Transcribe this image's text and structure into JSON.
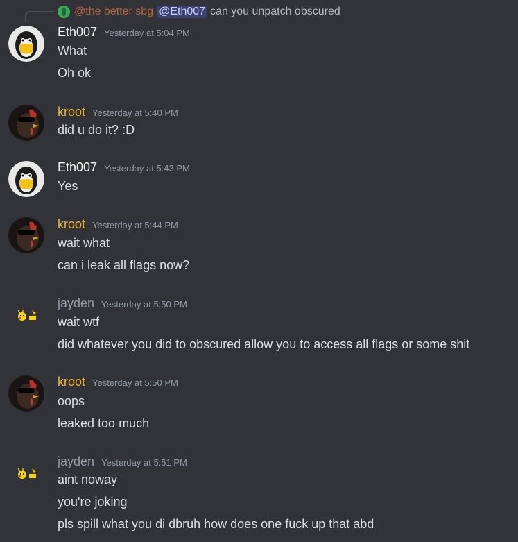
{
  "reply": {
    "author": "@the better sbg",
    "mention": "@Eth007",
    "text": "can you unpatch obscured"
  },
  "groups": [
    {
      "author": "Eth007",
      "author_color": "#f2f3f5",
      "avatar_icon": "penguin-mask-avatar",
      "timestamp": "Yesterday at 5:04 PM",
      "messages": [
        "What",
        "Oh ok"
      ]
    },
    {
      "author": "kroot",
      "author_color": "#f0b232",
      "avatar_icon": "rooster-sunglasses-avatar",
      "timestamp": "Yesterday at 5:40 PM",
      "messages": [
        "did u do it? :D"
      ]
    },
    {
      "author": "Eth007",
      "author_color": "#f2f3f5",
      "avatar_icon": "penguin-mask-avatar",
      "timestamp": "Yesterday at 5:43 PM",
      "messages": [
        "Yes"
      ]
    },
    {
      "author": "kroot",
      "author_color": "#f0b232",
      "avatar_icon": "rooster-sunglasses-avatar",
      "timestamp": "Yesterday at 5:44 PM",
      "messages": [
        "wait what",
        "can i leak all flags now?"
      ]
    },
    {
      "author": "jayden",
      "author_color": "#949ba4",
      "avatar_icon": "pikachu-avatar",
      "timestamp": "Yesterday at 5:50 PM",
      "messages": [
        "wait wtf",
        "did whatever you did to obscured allow you to access all flags or some shit"
      ]
    },
    {
      "author": "kroot",
      "author_color": "#f0b232",
      "avatar_icon": "rooster-sunglasses-avatar",
      "timestamp": "Yesterday at 5:50 PM",
      "messages": [
        "oops",
        "leaked too much"
      ]
    },
    {
      "author": "jayden",
      "author_color": "#949ba4",
      "avatar_icon": "pikachu-avatar",
      "timestamp": "Yesterday at 5:51 PM",
      "messages": [
        "aint noway",
        "you're joking",
        "pls spill what you di dbruh how does one fuck up that abd"
      ]
    }
  ]
}
